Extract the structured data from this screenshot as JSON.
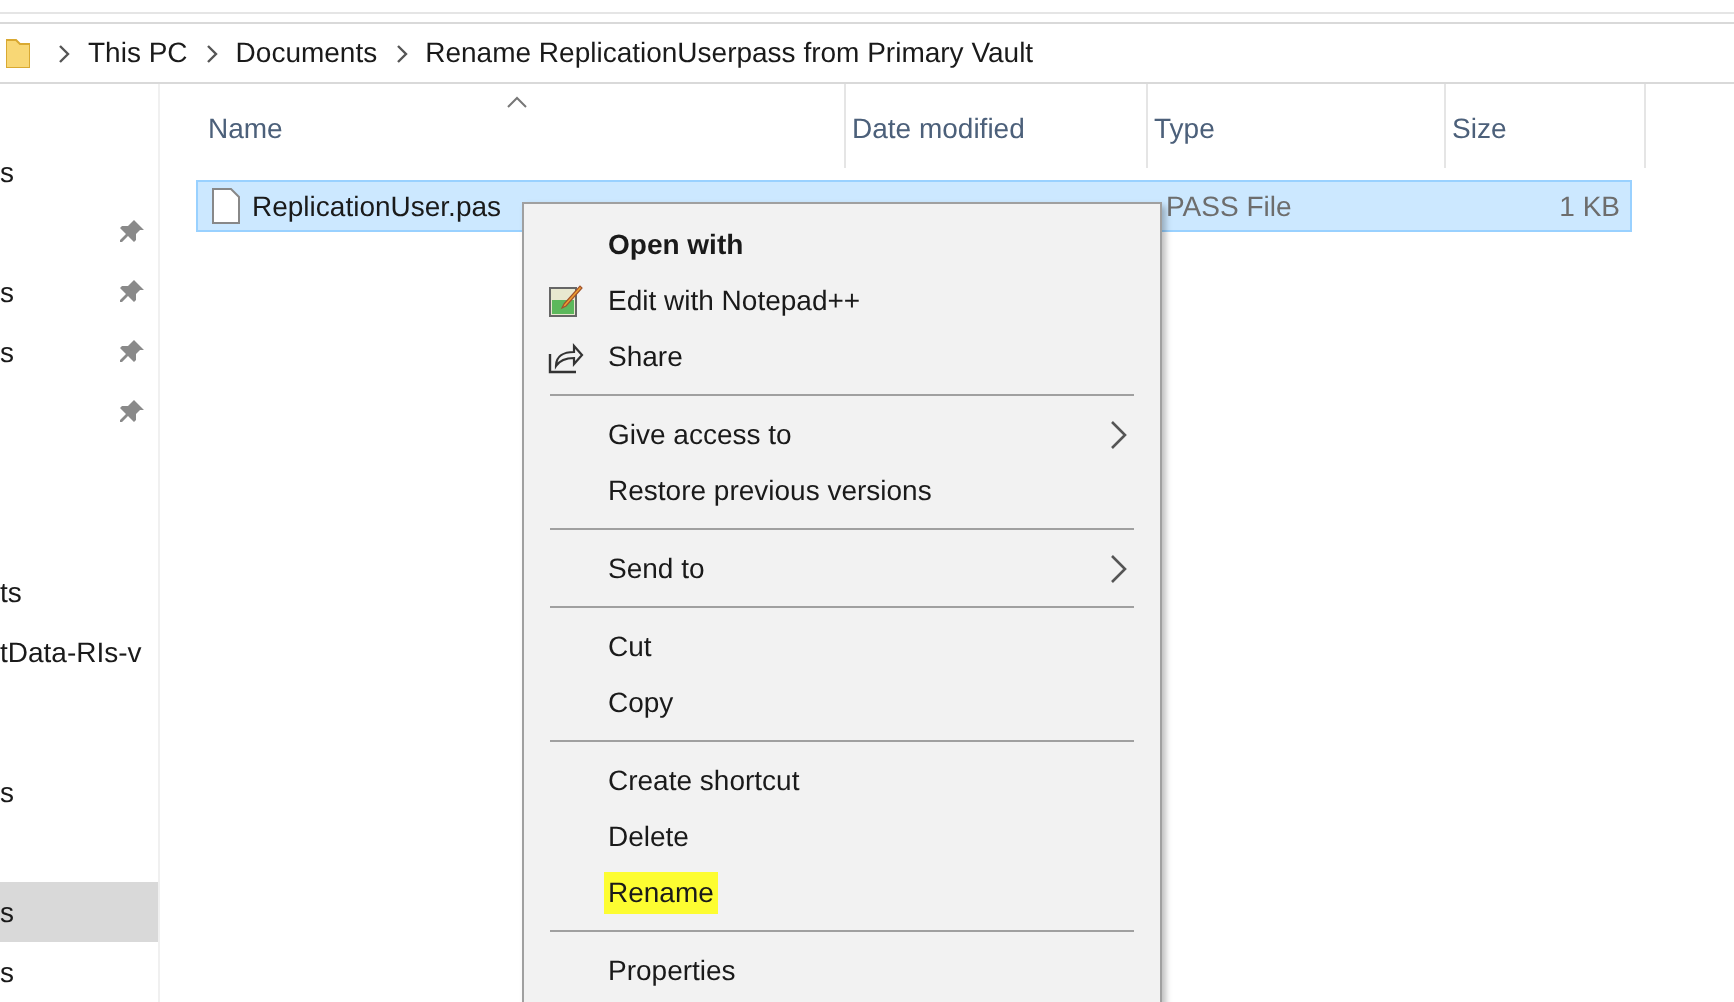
{
  "breadcrumb": [
    "This PC",
    "Documents",
    "Rename ReplicationUserpass from Primary Vault"
  ],
  "sidebar": {
    "sections": [
      {
        "rows": [
          {
            "label": "s",
            "pinned": false,
            "selected": false
          },
          {
            "pinned": true,
            "selected": false
          },
          {
            "label": "s",
            "pinned": true,
            "selected": false
          },
          {
            "label": "s",
            "pinned": true,
            "selected": false
          },
          {
            "pinned": true,
            "selected": false
          }
        ]
      },
      {
        "rows": [
          {
            "label": "ts",
            "pinned": false,
            "selected": false
          },
          {
            "label": "tData-RIs-v",
            "pinned": false,
            "selected": false
          }
        ]
      },
      {
        "rows": [
          {
            "label": "s",
            "pinned": false,
            "selected": false
          },
          {
            "pinned": false,
            "selected": false
          },
          {
            "label": "s",
            "pinned": false,
            "selected": true
          },
          {
            "label": "s",
            "pinned": false,
            "selected": false
          }
        ]
      }
    ]
  },
  "table": {
    "columns": [
      "Name",
      "Date modified",
      "Type",
      "Size"
    ],
    "rows": [
      {
        "name": "ReplicationUser.pas",
        "type": "PASS File",
        "size": "1 KB",
        "selected": true
      }
    ]
  },
  "context_menu": {
    "items": [
      {
        "kind": "item",
        "label": "Open with",
        "bold": true,
        "submenu": false,
        "highlighted": false
      },
      {
        "kind": "icon-item",
        "label": "Edit with Notepad++",
        "bold": false,
        "submenu": false,
        "highlighted": false
      },
      {
        "kind": "icon-item",
        "label": "Share",
        "bold": false,
        "submenu": false,
        "highlighted": false
      },
      {
        "kind": "separator"
      },
      {
        "kind": "item",
        "label": "Give access to",
        "bold": false,
        "submenu": true,
        "highlighted": false
      },
      {
        "kind": "item",
        "label": "Restore previous versions",
        "bold": false,
        "submenu": false,
        "highlighted": false
      },
      {
        "kind": "separator"
      },
      {
        "kind": "item",
        "label": "Send to",
        "bold": false,
        "submenu": true,
        "highlighted": false
      },
      {
        "kind": "separator"
      },
      {
        "kind": "item",
        "label": "Cut",
        "bold": false,
        "submenu": false,
        "highlighted": false
      },
      {
        "kind": "item",
        "label": "Copy",
        "bold": false,
        "submenu": false,
        "highlighted": false
      },
      {
        "kind": "separator"
      },
      {
        "kind": "item",
        "label": "Create shortcut",
        "bold": false,
        "submenu": false,
        "highlighted": false
      },
      {
        "kind": "item",
        "label": "Delete",
        "bold": false,
        "submenu": false,
        "highlighted": false
      },
      {
        "kind": "item",
        "label": "Rename",
        "bold": false,
        "submenu": false,
        "highlighted": true
      },
      {
        "kind": "separator"
      },
      {
        "kind": "item",
        "label": "Properties",
        "bold": false,
        "submenu": false,
        "highlighted": false
      }
    ]
  }
}
